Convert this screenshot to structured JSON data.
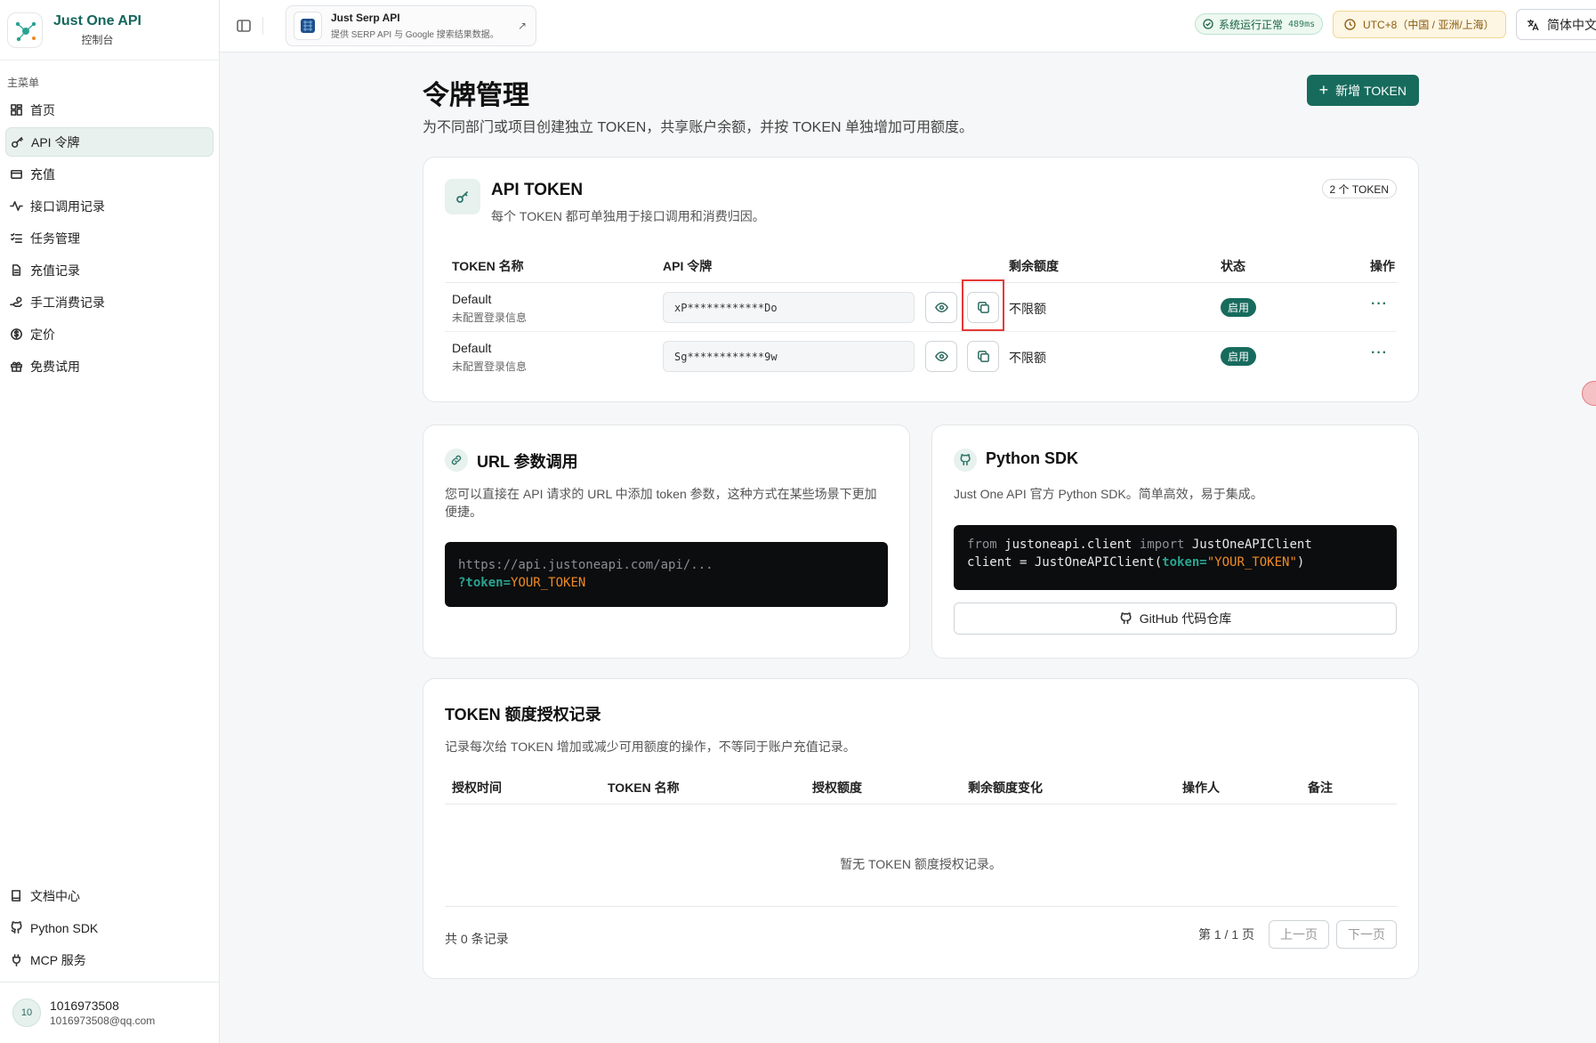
{
  "brand": {
    "title": "Just One API",
    "subtitle": "控制台"
  },
  "sidebar": {
    "section_label": "主菜单",
    "items": [
      {
        "label": "首页",
        "icon": "dashboard-icon"
      },
      {
        "label": "API 令牌",
        "icon": "key-icon",
        "active": true
      },
      {
        "label": "充值",
        "icon": "credit-card-icon"
      },
      {
        "label": "接口调用记录",
        "icon": "activity-icon"
      },
      {
        "label": "任务管理",
        "icon": "task-list-icon"
      },
      {
        "label": "充值记录",
        "icon": "document-icon"
      },
      {
        "label": "手工消费记录",
        "icon": "hand-coins-icon"
      },
      {
        "label": "定价",
        "icon": "dollar-circle-icon"
      },
      {
        "label": "免费试用",
        "icon": "gift-icon"
      }
    ],
    "bottom_items": [
      {
        "label": "文档中心",
        "icon": "book-icon"
      },
      {
        "label": "Python SDK",
        "icon": "github-icon"
      },
      {
        "label": "MCP 服务",
        "icon": "plug-icon"
      }
    ],
    "user": {
      "initials": "10",
      "name": "1016973508",
      "email": "1016973508@qq.com"
    }
  },
  "topbar": {
    "promo": {
      "title": "Just Serp API",
      "desc": "提供 SERP API 与 Google 搜索结果数据。"
    },
    "status": {
      "label": "系统运行正常",
      "latency": "489ms"
    },
    "timezone": "UTC+8（中国 / 亚洲/上海）",
    "language": "简体中文"
  },
  "page": {
    "title": "令牌管理",
    "desc": "为不同部门或项目创建独立 TOKEN，共享账户余额，并按 TOKEN 单独增加可用额度。",
    "new_button": "新增 TOKEN"
  },
  "token_card": {
    "title": "API TOKEN",
    "desc": "每个 TOKEN 都可单独用于接口调用和消费归因。",
    "count_badge": "2 个 TOKEN",
    "columns": [
      "TOKEN 名称",
      "API 令牌",
      "剩余额度",
      "状态",
      "操作"
    ],
    "rows": [
      {
        "name": "Default",
        "sub": "未配置登录信息",
        "token": "xP************Do",
        "quota": "不限额",
        "status": "启用"
      },
      {
        "name": "Default",
        "sub": "未配置登录信息",
        "token": "Sg************9w",
        "quota": "不限额",
        "status": "启用"
      }
    ],
    "more_label": "···"
  },
  "url_card": {
    "title": "URL 参数调用",
    "desc": "您可以直接在 API 请求的 URL 中添加 token 参数，这种方式在某些场景下更加便捷。",
    "code_line1": "https://api.justoneapi.com/api/...",
    "code_param": "?token=",
    "code_value": "YOUR_TOKEN"
  },
  "sdk_card": {
    "title": "Python SDK",
    "desc": "Just One API 官方 Python SDK。简单高效，易于集成。",
    "code_from": "from",
    "code_module": " justoneapi.client ",
    "code_import": "import",
    "code_class": " JustOneAPIClient",
    "code_line2_a": "client = JustOneAPIClient(",
    "code_kw": "token=",
    "code_str": "\"YOUR_TOKEN\"",
    "code_close": ")",
    "github_button": "GitHub 代码仓库"
  },
  "log_card": {
    "title": "TOKEN 额度授权记录",
    "desc": "记录每次给 TOKEN 增加或减少可用额度的操作，不等同于账户充值记录。",
    "columns": [
      "授权时间",
      "TOKEN 名称",
      "授权额度",
      "剩余额度变化",
      "操作人",
      "备注"
    ],
    "empty": "暂无 TOKEN 额度授权记录。",
    "total": "共 0 条记录",
    "page_info": "第 1 / 1 页",
    "prev": "上一页",
    "next": "下一页"
  },
  "colors": {
    "brand": "#176b5d",
    "highlight": "#e53935"
  }
}
